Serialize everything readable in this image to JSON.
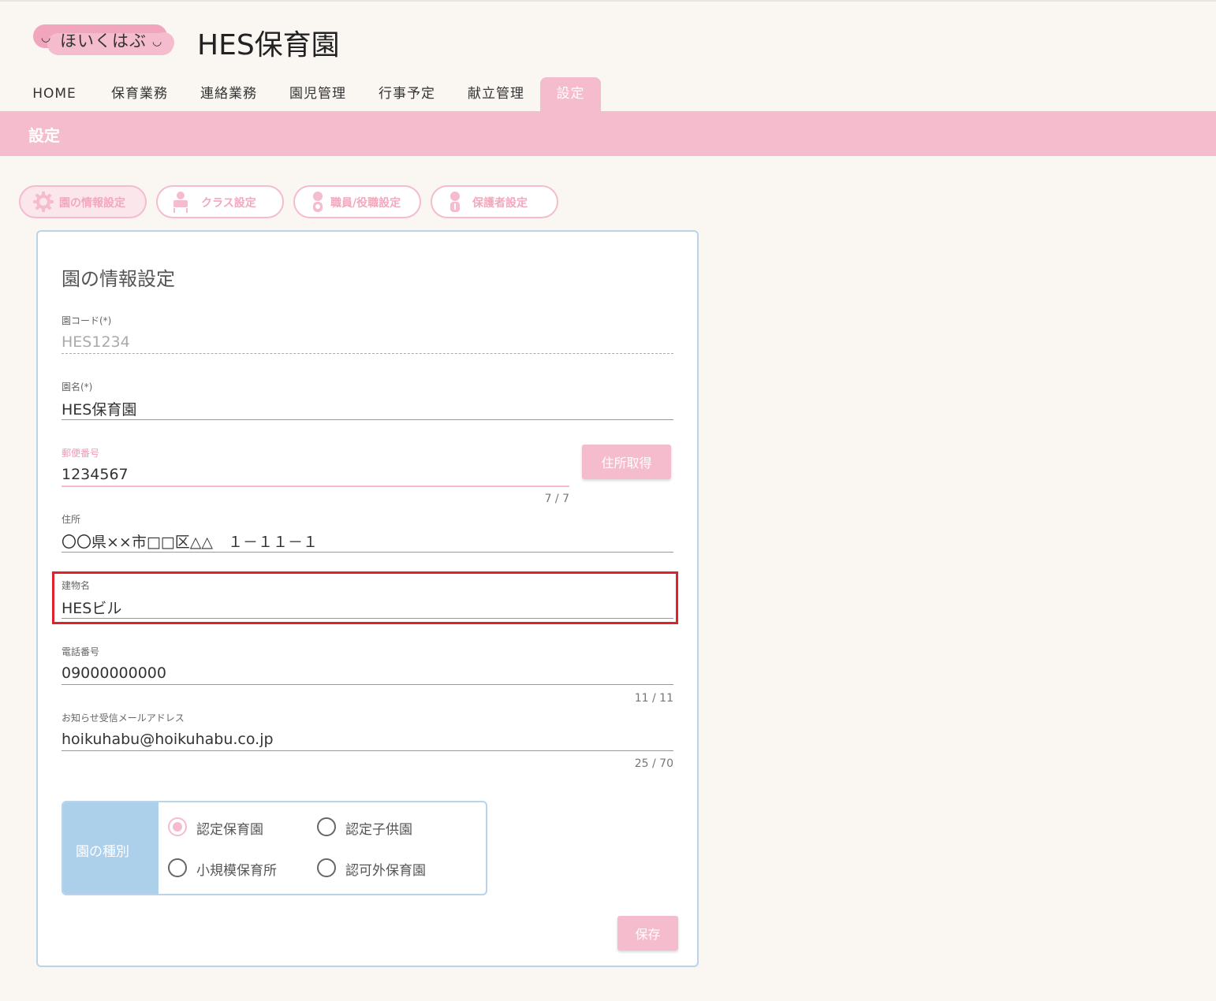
{
  "header": {
    "logo_text": "ほいくはぶ",
    "logo_smile": "◡",
    "site_title": "HES保育園"
  },
  "nav": {
    "items": [
      "HOME",
      "保育業務",
      "連絡業務",
      "園児管理",
      "行事予定",
      "献立管理",
      "設定"
    ],
    "active": "設定"
  },
  "page": {
    "title": "設定"
  },
  "subtabs": [
    {
      "label": "園の情報設定",
      "icon": "gear-icon"
    },
    {
      "label": "クラス設定",
      "icon": "class-icon"
    },
    {
      "label": "職員/役職設定",
      "icon": "staff-icon"
    },
    {
      "label": "保護者設定",
      "icon": "guardian-icon"
    }
  ],
  "form": {
    "title": "園の情報設定",
    "code": {
      "label": "園コード(*)",
      "value": "HES1234"
    },
    "name": {
      "label": "園名(*)",
      "value": "HES保育園"
    },
    "postal": {
      "label": "郵便番号",
      "value": "1234567",
      "counter": "7 / 7"
    },
    "address_button": "住所取得",
    "address": {
      "label": "住所",
      "value": "〇〇県××市□□区△△　１－１１－１"
    },
    "building": {
      "label": "建物名",
      "value": "HESビル"
    },
    "phone": {
      "label": "電話番号",
      "value": "09000000000",
      "counter": "11 / 11"
    },
    "email": {
      "label": "お知らせ受信メールアドレス",
      "value": "hoikuhabu@hoikuhabu.co.jp",
      "counter": "25 / 70"
    },
    "type": {
      "label": "園の種別",
      "options": [
        "認定保育園",
        "認定子供園",
        "小規模保育所",
        "認可外保育園"
      ],
      "selected": "認定保育園"
    },
    "save_button": "保存"
  },
  "colors": {
    "pink": "#f4bccd",
    "blue": "#acd0ea",
    "highlight": "#e0202a",
    "background": "#faf7f2"
  }
}
